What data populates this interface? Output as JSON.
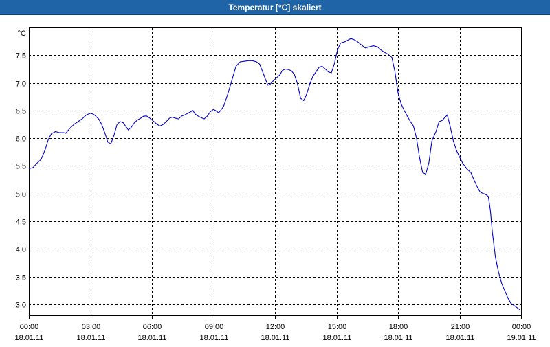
{
  "window": {
    "title": "Temperatur [°C] skaliert"
  },
  "chart_data": {
    "type": "line",
    "title": "Temperatur [°C] skaliert",
    "unit_label": "°C",
    "xlabel": "",
    "ylabel": "",
    "x_unit": "hours",
    "xlim": [
      0,
      24
    ],
    "ylim": [
      2.8,
      8.0
    ],
    "grid": true,
    "y_ticks": [
      {
        "v": 3.0,
        "label": "3,0"
      },
      {
        "v": 3.5,
        "label": "3,5"
      },
      {
        "v": 4.0,
        "label": "4,0"
      },
      {
        "v": 4.5,
        "label": "4,5"
      },
      {
        "v": 5.0,
        "label": "5,0"
      },
      {
        "v": 5.5,
        "label": "5,5"
      },
      {
        "v": 6.0,
        "label": "6,0"
      },
      {
        "v": 6.5,
        "label": "6,5"
      },
      {
        "v": 7.0,
        "label": "7,0"
      },
      {
        "v": 7.5,
        "label": "7,5"
      }
    ],
    "x_ticks": [
      {
        "h": 0,
        "time": "00:00",
        "date": "18.01.11"
      },
      {
        "h": 3,
        "time": "03:00",
        "date": "18.01.11"
      },
      {
        "h": 6,
        "time": "06:00",
        "date": "18.01.11"
      },
      {
        "h": 9,
        "time": "09:00",
        "date": "18.01.11"
      },
      {
        "h": 12,
        "time": "12:00",
        "date": "18.01.11"
      },
      {
        "h": 15,
        "time": "15:00",
        "date": "18.01.11"
      },
      {
        "h": 18,
        "time": "18:00",
        "date": "18.01.11"
      },
      {
        "h": 21,
        "time": "21:00",
        "date": "18.01.11"
      },
      {
        "h": 24,
        "time": "00:00",
        "date": "19.01.11"
      }
    ],
    "series": [
      {
        "color": "#0000c8",
        "points": [
          [
            0.0,
            5.45
          ],
          [
            0.2,
            5.47
          ],
          [
            0.4,
            5.55
          ],
          [
            0.6,
            5.62
          ],
          [
            0.8,
            5.8
          ],
          [
            0.95,
            5.98
          ],
          [
            1.1,
            6.08
          ],
          [
            1.3,
            6.12
          ],
          [
            1.5,
            6.1
          ],
          [
            1.7,
            6.1
          ],
          [
            1.8,
            6.09
          ],
          [
            2.0,
            6.18
          ],
          [
            2.2,
            6.25
          ],
          [
            2.4,
            6.3
          ],
          [
            2.6,
            6.35
          ],
          [
            2.8,
            6.42
          ],
          [
            3.0,
            6.45
          ],
          [
            3.1,
            6.44
          ],
          [
            3.2,
            6.42
          ],
          [
            3.4,
            6.35
          ],
          [
            3.55,
            6.25
          ],
          [
            3.7,
            6.1
          ],
          [
            3.85,
            5.93
          ],
          [
            4.0,
            5.9
          ],
          [
            4.15,
            6.05
          ],
          [
            4.3,
            6.25
          ],
          [
            4.45,
            6.3
          ],
          [
            4.6,
            6.28
          ],
          [
            4.75,
            6.2
          ],
          [
            4.85,
            6.15
          ],
          [
            5.0,
            6.2
          ],
          [
            5.15,
            6.28
          ],
          [
            5.3,
            6.33
          ],
          [
            5.45,
            6.36
          ],
          [
            5.6,
            6.4
          ],
          [
            5.75,
            6.4
          ],
          [
            5.9,
            6.36
          ],
          [
            6.1,
            6.3
          ],
          [
            6.25,
            6.25
          ],
          [
            6.4,
            6.22
          ],
          [
            6.55,
            6.25
          ],
          [
            6.7,
            6.3
          ],
          [
            6.85,
            6.36
          ],
          [
            7.0,
            6.38
          ],
          [
            7.15,
            6.36
          ],
          [
            7.3,
            6.35
          ],
          [
            7.45,
            6.4
          ],
          [
            7.6,
            6.42
          ],
          [
            7.75,
            6.45
          ],
          [
            7.9,
            6.48
          ],
          [
            8.0,
            6.5
          ],
          [
            8.1,
            6.44
          ],
          [
            8.25,
            6.4
          ],
          [
            8.4,
            6.37
          ],
          [
            8.55,
            6.35
          ],
          [
            8.7,
            6.4
          ],
          [
            8.85,
            6.48
          ],
          [
            9.0,
            6.52
          ],
          [
            9.1,
            6.5
          ],
          [
            9.25,
            6.46
          ],
          [
            9.35,
            6.5
          ],
          [
            9.5,
            6.58
          ],
          [
            9.7,
            6.8
          ],
          [
            9.9,
            7.05
          ],
          [
            10.1,
            7.3
          ],
          [
            10.3,
            7.38
          ],
          [
            10.5,
            7.39
          ],
          [
            10.7,
            7.4
          ],
          [
            10.9,
            7.4
          ],
          [
            11.1,
            7.38
          ],
          [
            11.25,
            7.34
          ],
          [
            11.4,
            7.2
          ],
          [
            11.55,
            7.05
          ],
          [
            11.65,
            6.96
          ],
          [
            11.75,
            6.97
          ],
          [
            11.9,
            7.03
          ],
          [
            12.1,
            7.1
          ],
          [
            12.25,
            7.15
          ],
          [
            12.35,
            7.22
          ],
          [
            12.5,
            7.25
          ],
          [
            12.65,
            7.24
          ],
          [
            12.8,
            7.22
          ],
          [
            12.95,
            7.15
          ],
          [
            13.1,
            6.98
          ],
          [
            13.25,
            6.72
          ],
          [
            13.4,
            6.68
          ],
          [
            13.55,
            6.8
          ],
          [
            13.7,
            6.98
          ],
          [
            13.85,
            7.12
          ],
          [
            14.0,
            7.2
          ],
          [
            14.15,
            7.28
          ],
          [
            14.3,
            7.3
          ],
          [
            14.45,
            7.25
          ],
          [
            14.6,
            7.2
          ],
          [
            14.75,
            7.18
          ],
          [
            14.9,
            7.35
          ],
          [
            15.05,
            7.6
          ],
          [
            15.2,
            7.72
          ],
          [
            15.4,
            7.74
          ],
          [
            15.55,
            7.77
          ],
          [
            15.7,
            7.8
          ],
          [
            15.85,
            7.78
          ],
          [
            16.0,
            7.75
          ],
          [
            16.2,
            7.69
          ],
          [
            16.4,
            7.63
          ],
          [
            16.6,
            7.65
          ],
          [
            16.8,
            7.67
          ],
          [
            17.0,
            7.65
          ],
          [
            17.15,
            7.6
          ],
          [
            17.3,
            7.56
          ],
          [
            17.5,
            7.52
          ],
          [
            17.7,
            7.46
          ],
          [
            17.85,
            7.2
          ],
          [
            18.0,
            6.82
          ],
          [
            18.15,
            6.62
          ],
          [
            18.3,
            6.5
          ],
          [
            18.45,
            6.4
          ],
          [
            18.6,
            6.3
          ],
          [
            18.75,
            6.22
          ],
          [
            18.9,
            6.0
          ],
          [
            19.05,
            5.65
          ],
          [
            19.2,
            5.38
          ],
          [
            19.35,
            5.35
          ],
          [
            19.5,
            5.55
          ],
          [
            19.65,
            5.95
          ],
          [
            19.85,
            6.12
          ],
          [
            20.0,
            6.3
          ],
          [
            20.15,
            6.32
          ],
          [
            20.3,
            6.38
          ],
          [
            20.4,
            6.42
          ],
          [
            20.55,
            6.2
          ],
          [
            20.7,
            5.95
          ],
          [
            20.85,
            5.78
          ],
          [
            21.0,
            5.66
          ],
          [
            21.15,
            5.55
          ],
          [
            21.35,
            5.45
          ],
          [
            21.55,
            5.38
          ],
          [
            21.7,
            5.25
          ],
          [
            21.85,
            5.13
          ],
          [
            22.0,
            5.03
          ],
          [
            22.15,
            5.0
          ],
          [
            22.25,
            4.99
          ],
          [
            22.4,
            4.95
          ],
          [
            22.5,
            4.7
          ],
          [
            22.6,
            4.3
          ],
          [
            22.75,
            3.85
          ],
          [
            22.9,
            3.58
          ],
          [
            23.05,
            3.38
          ],
          [
            23.2,
            3.25
          ],
          [
            23.35,
            3.12
          ],
          [
            23.5,
            3.02
          ],
          [
            23.65,
            2.98
          ],
          [
            23.8,
            2.94
          ],
          [
            23.95,
            2.9
          ]
        ]
      }
    ]
  }
}
